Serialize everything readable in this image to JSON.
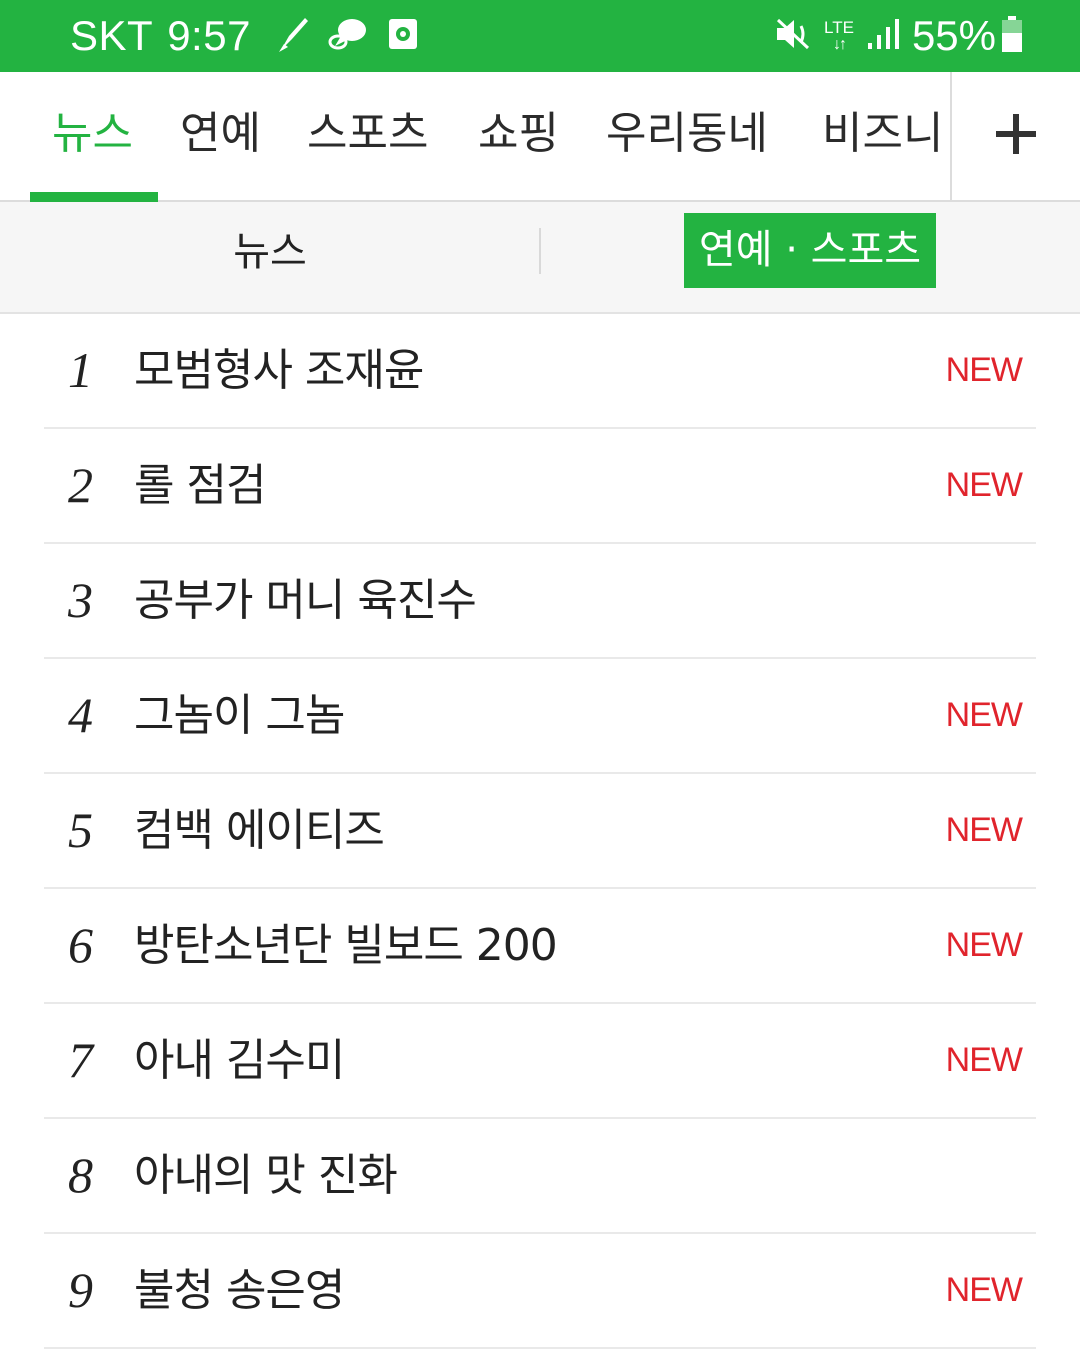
{
  "status_bar": {
    "carrier": "SKT",
    "time": "9:57",
    "network": "LTE",
    "battery": "55%",
    "left_icons": [
      "brush-icon",
      "chat-icon",
      "screenshot-icon"
    ],
    "right_icons": [
      "mute-vibrate-icon",
      "lte-data-icon",
      "signal-icon",
      "battery-icon"
    ]
  },
  "tabs": [
    {
      "label": "뉴스",
      "active": true
    },
    {
      "label": "연예",
      "active": false
    },
    {
      "label": "스포츠",
      "active": false
    },
    {
      "label": "쇼핑",
      "active": false
    },
    {
      "label": "우리동네",
      "active": false
    },
    {
      "label": "비즈니",
      "active": false
    }
  ],
  "add_tab_icon": "plus-icon",
  "segment": {
    "news_label": "뉴스",
    "entertainment_label": "연예 · 스포츠",
    "selected": "entertainment"
  },
  "ranking": [
    {
      "rank": "1",
      "keyword": "모범형사 조재윤",
      "badge": "NEW"
    },
    {
      "rank": "2",
      "keyword": "롤 점검",
      "badge": "NEW"
    },
    {
      "rank": "3",
      "keyword": "공부가 머니 육진수",
      "badge": ""
    },
    {
      "rank": "4",
      "keyword": "그놈이 그놈",
      "badge": "NEW"
    },
    {
      "rank": "5",
      "keyword": "컴백 에이티즈",
      "badge": "NEW"
    },
    {
      "rank": "6",
      "keyword": "방탄소년단 빌보드 200",
      "badge": "NEW"
    },
    {
      "rank": "7",
      "keyword": "아내 김수미",
      "badge": "NEW"
    },
    {
      "rank": "8",
      "keyword": "아내의 맛 진화",
      "badge": ""
    },
    {
      "rank": "9",
      "keyword": "불청 송은영",
      "badge": "NEW"
    }
  ],
  "colors": {
    "brand_green": "#23b341",
    "new_badge_red": "#e0242c"
  }
}
